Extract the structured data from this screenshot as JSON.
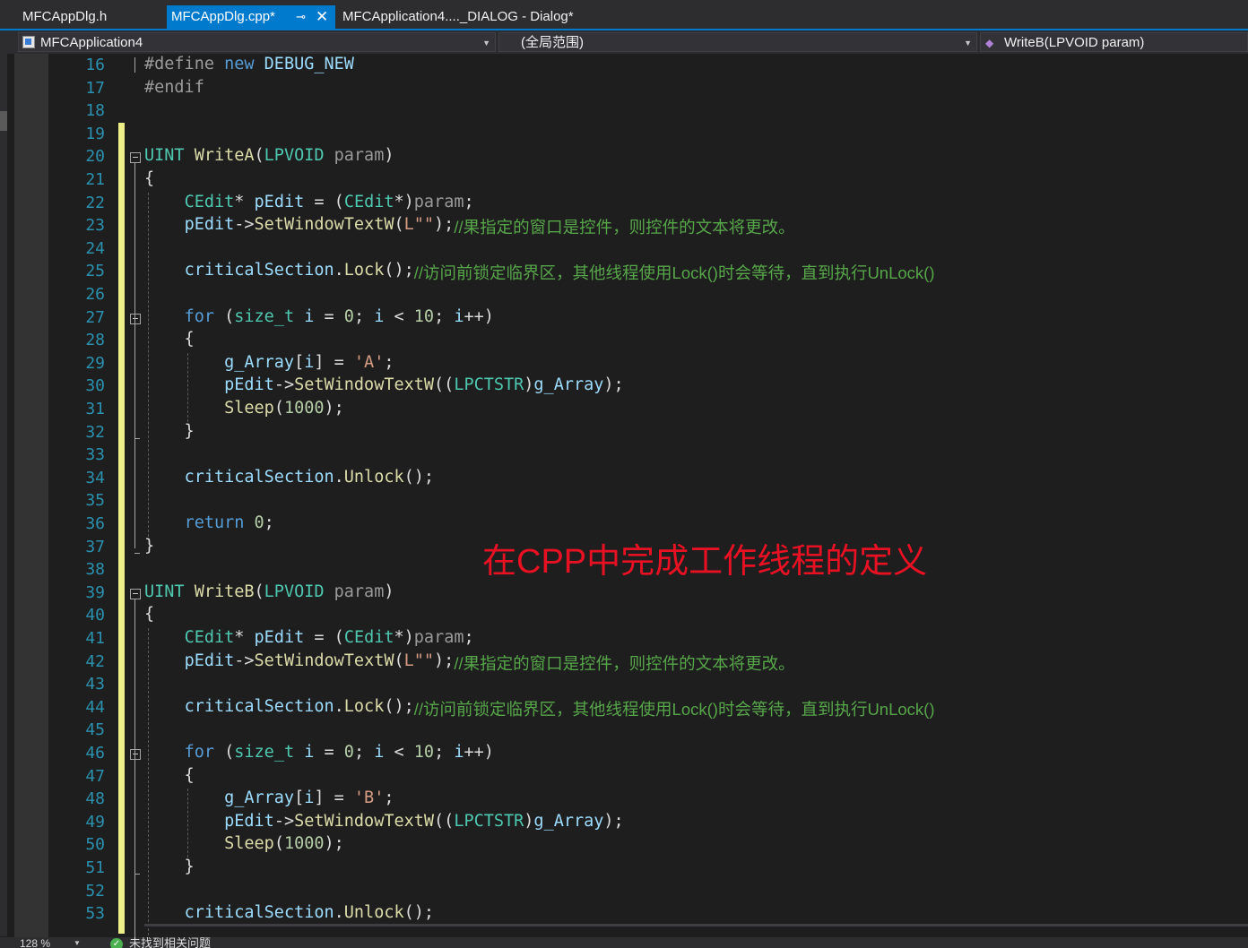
{
  "tabs": [
    {
      "label": "MFCAppDlg.h",
      "active": false
    },
    {
      "label": "MFCAppDlg.cpp*",
      "active": true,
      "pin_icon": "pin-icon",
      "close_icon": "close-icon"
    },
    {
      "label": "MFCApplication4...._DIALOG - Dialog*",
      "active": false
    }
  ],
  "nav": {
    "project": "MFCApplication4",
    "scope": "(全局范围)",
    "member": "WriteB(LPVOID param)"
  },
  "colors": {
    "accent": "#007acc",
    "keyword": "#569cd6",
    "type": "#4ec9b0",
    "function": "#dcdcaa",
    "variable": "#9cdcfe",
    "string": "#d69d85",
    "number": "#b5cea8",
    "preprocessor": "#9b9b9b",
    "comment": "#57a64a",
    "line_number": "#2b91af",
    "annotation": "#e81123"
  },
  "editor": {
    "lines": [
      {
        "num": "16",
        "code": [
          [
            "#define",
            "preprocessor"
          ],
          [
            " new ",
            "keyword"
          ],
          [
            "DEBUG_NEW",
            "macro"
          ]
        ]
      },
      {
        "num": "17",
        "code": [
          [
            "#endif",
            "preprocessor"
          ]
        ]
      },
      {
        "num": "18",
        "code": []
      },
      {
        "num": "19",
        "code": []
      },
      {
        "num": "20",
        "code": [
          [
            "UINT",
            "type"
          ],
          [
            " ",
            "plain"
          ],
          [
            "WriteA",
            "function"
          ],
          [
            "(",
            "plain"
          ],
          [
            "LPVOID",
            "type"
          ],
          [
            " param",
            "param"
          ],
          [
            ")",
            "plain"
          ]
        ]
      },
      {
        "num": "21",
        "code": [
          [
            "{",
            "plain"
          ]
        ]
      },
      {
        "num": "22",
        "code": [
          [
            "    ",
            "plain"
          ],
          [
            "CEdit",
            "type"
          ],
          [
            "* ",
            "plain"
          ],
          [
            "pEdit",
            "variable"
          ],
          [
            " = (",
            "plain"
          ],
          [
            "CEdit",
            "type"
          ],
          [
            "*)",
            "plain"
          ],
          [
            "param",
            "param"
          ],
          [
            ";",
            "plain"
          ]
        ]
      },
      {
        "num": "23",
        "code": [
          [
            "    ",
            "plain"
          ],
          [
            "pEdit",
            "variable"
          ],
          [
            "->",
            "plain"
          ],
          [
            "SetWindowTextW",
            "function"
          ],
          [
            "(",
            "plain"
          ],
          [
            "L\"\"",
            "string"
          ],
          [
            ");",
            "plain"
          ]
        ],
        "comment": "//果指定的窗口是控件，则控件的文本将更改。"
      },
      {
        "num": "24",
        "code": []
      },
      {
        "num": "25",
        "code": [
          [
            "    ",
            "plain"
          ],
          [
            "criticalSection",
            "variable"
          ],
          [
            ".",
            "plain"
          ],
          [
            "Lock",
            "function"
          ],
          [
            "();",
            "plain"
          ]
        ],
        "comment": "//访问前锁定临界区，其他线程使用Lock()时会等待，直到执行UnLock()"
      },
      {
        "num": "26",
        "code": []
      },
      {
        "num": "27",
        "code": [
          [
            "    ",
            "plain"
          ],
          [
            "for",
            "keyword"
          ],
          [
            " (",
            "plain"
          ],
          [
            "size_t",
            "type"
          ],
          [
            " ",
            "plain"
          ],
          [
            "i",
            "variable"
          ],
          [
            " = ",
            "plain"
          ],
          [
            "0",
            "number"
          ],
          [
            "; ",
            "plain"
          ],
          [
            "i",
            "variable"
          ],
          [
            " < ",
            "plain"
          ],
          [
            "10",
            "number"
          ],
          [
            "; ",
            "plain"
          ],
          [
            "i",
            "variable"
          ],
          [
            "++)",
            "plain"
          ]
        ]
      },
      {
        "num": "28",
        "code": [
          [
            "    {",
            "plain"
          ]
        ]
      },
      {
        "num": "29",
        "code": [
          [
            "        ",
            "plain"
          ],
          [
            "g_Array",
            "variable"
          ],
          [
            "[",
            "plain"
          ],
          [
            "i",
            "variable"
          ],
          [
            "] = ",
            "plain"
          ],
          [
            "'A'",
            "string"
          ],
          [
            ";",
            "plain"
          ]
        ]
      },
      {
        "num": "30",
        "code": [
          [
            "        ",
            "plain"
          ],
          [
            "pEdit",
            "variable"
          ],
          [
            "->",
            "plain"
          ],
          [
            "SetWindowTextW",
            "function"
          ],
          [
            "((",
            "plain"
          ],
          [
            "LPCTSTR",
            "type"
          ],
          [
            ")",
            "plain"
          ],
          [
            "g_Array",
            "variable"
          ],
          [
            ");",
            "plain"
          ]
        ]
      },
      {
        "num": "31",
        "code": [
          [
            "        ",
            "plain"
          ],
          [
            "Sleep",
            "function"
          ],
          [
            "(",
            "plain"
          ],
          [
            "1000",
            "number"
          ],
          [
            ");",
            "plain"
          ]
        ]
      },
      {
        "num": "32",
        "code": [
          [
            "    }",
            "plain"
          ]
        ]
      },
      {
        "num": "33",
        "code": []
      },
      {
        "num": "34",
        "code": [
          [
            "    ",
            "plain"
          ],
          [
            "criticalSection",
            "variable"
          ],
          [
            ".",
            "plain"
          ],
          [
            "Unlock",
            "function"
          ],
          [
            "();",
            "plain"
          ]
        ]
      },
      {
        "num": "35",
        "code": []
      },
      {
        "num": "36",
        "code": [
          [
            "    ",
            "plain"
          ],
          [
            "return",
            "keyword"
          ],
          [
            " ",
            "plain"
          ],
          [
            "0",
            "number"
          ],
          [
            ";",
            "plain"
          ]
        ]
      },
      {
        "num": "37",
        "code": [
          [
            "}",
            "plain"
          ]
        ]
      },
      {
        "num": "38",
        "code": []
      },
      {
        "num": "39",
        "code": [
          [
            "UINT",
            "type"
          ],
          [
            " ",
            "plain"
          ],
          [
            "WriteB",
            "function"
          ],
          [
            "(",
            "plain"
          ],
          [
            "LPVOID",
            "type"
          ],
          [
            " param",
            "param"
          ],
          [
            ")",
            "plain"
          ]
        ]
      },
      {
        "num": "40",
        "code": [
          [
            "{",
            "plain"
          ]
        ]
      },
      {
        "num": "41",
        "code": [
          [
            "    ",
            "plain"
          ],
          [
            "CEdit",
            "type"
          ],
          [
            "* ",
            "plain"
          ],
          [
            "pEdit",
            "variable"
          ],
          [
            " = (",
            "plain"
          ],
          [
            "CEdit",
            "type"
          ],
          [
            "*)",
            "plain"
          ],
          [
            "param",
            "param"
          ],
          [
            ";",
            "plain"
          ]
        ]
      },
      {
        "num": "42",
        "code": [
          [
            "    ",
            "plain"
          ],
          [
            "pEdit",
            "variable"
          ],
          [
            "->",
            "plain"
          ],
          [
            "SetWindowTextW",
            "function"
          ],
          [
            "(",
            "plain"
          ],
          [
            "L\"\"",
            "string"
          ],
          [
            ");",
            "plain"
          ]
        ],
        "comment": "//果指定的窗口是控件，则控件的文本将更改。"
      },
      {
        "num": "43",
        "code": []
      },
      {
        "num": "44",
        "code": [
          [
            "    ",
            "plain"
          ],
          [
            "criticalSection",
            "variable"
          ],
          [
            ".",
            "plain"
          ],
          [
            "Lock",
            "function"
          ],
          [
            "();",
            "plain"
          ]
        ],
        "comment": "//访问前锁定临界区，其他线程使用Lock()时会等待，直到执行UnLock()"
      },
      {
        "num": "45",
        "code": []
      },
      {
        "num": "46",
        "code": [
          [
            "    ",
            "plain"
          ],
          [
            "for",
            "keyword"
          ],
          [
            " (",
            "plain"
          ],
          [
            "size_t",
            "type"
          ],
          [
            " ",
            "plain"
          ],
          [
            "i",
            "variable"
          ],
          [
            " = ",
            "plain"
          ],
          [
            "0",
            "number"
          ],
          [
            "; ",
            "plain"
          ],
          [
            "i",
            "variable"
          ],
          [
            " < ",
            "plain"
          ],
          [
            "10",
            "number"
          ],
          [
            "; ",
            "plain"
          ],
          [
            "i",
            "variable"
          ],
          [
            "++)",
            "plain"
          ]
        ]
      },
      {
        "num": "47",
        "code": [
          [
            "    {",
            "plain"
          ]
        ]
      },
      {
        "num": "48",
        "code": [
          [
            "        ",
            "plain"
          ],
          [
            "g_Array",
            "variable"
          ],
          [
            "[",
            "plain"
          ],
          [
            "i",
            "variable"
          ],
          [
            "] = ",
            "plain"
          ],
          [
            "'B'",
            "string"
          ],
          [
            ";",
            "plain"
          ]
        ]
      },
      {
        "num": "49",
        "code": [
          [
            "        ",
            "plain"
          ],
          [
            "pEdit",
            "variable"
          ],
          [
            "->",
            "plain"
          ],
          [
            "SetWindowTextW",
            "function"
          ],
          [
            "((",
            "plain"
          ],
          [
            "LPCTSTR",
            "type"
          ],
          [
            ")",
            "plain"
          ],
          [
            "g_Array",
            "variable"
          ],
          [
            ");",
            "plain"
          ]
        ]
      },
      {
        "num": "50",
        "code": [
          [
            "        ",
            "plain"
          ],
          [
            "Sleep",
            "function"
          ],
          [
            "(",
            "plain"
          ],
          [
            "1000",
            "number"
          ],
          [
            ");",
            "plain"
          ]
        ]
      },
      {
        "num": "51",
        "code": [
          [
            "    }",
            "plain"
          ]
        ]
      },
      {
        "num": "52",
        "code": []
      },
      {
        "num": "53",
        "code": [
          [
            "    ",
            "plain"
          ],
          [
            "criticalSection",
            "variable"
          ],
          [
            ".",
            "plain"
          ],
          [
            "Unlock",
            "function"
          ],
          [
            "();",
            "plain"
          ]
        ]
      }
    ]
  },
  "annotation": "在CPP中完成工作线程的定义",
  "status": {
    "zoom": "128 %",
    "issues": "未找到相关问题"
  }
}
